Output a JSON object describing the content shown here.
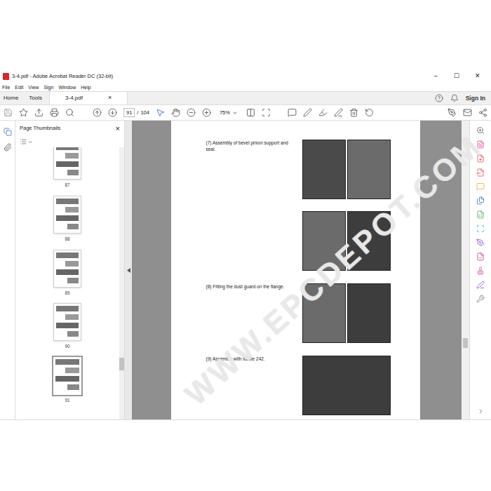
{
  "window": {
    "title": "3-4.pdf - Adobe Acrobat Reader DC (32-bit)",
    "controls": [
      "–",
      "☐",
      "✕"
    ]
  },
  "menu": [
    "File",
    "Edit",
    "View",
    "Sign",
    "Window",
    "Help"
  ],
  "tabs": [
    {
      "label": "Home",
      "selected": false
    },
    {
      "label": "Tools",
      "selected": false
    },
    {
      "label": "3-4.pdf",
      "selected": true
    }
  ],
  "tab_close": "×",
  "account": {
    "sign_in": "Sign In"
  },
  "toolbar": {
    "page": "91",
    "separator": "/",
    "total": "104",
    "zoom": "75%"
  },
  "thumbnails": {
    "title": "Page Thumbnails",
    "close": "×",
    "pages": [
      {
        "number": "87",
        "selected": false
      },
      {
        "number": "88",
        "selected": false
      },
      {
        "number": "89",
        "selected": false
      },
      {
        "number": "90",
        "selected": false
      },
      {
        "number": "91",
        "selected": true
      }
    ]
  },
  "document": {
    "watermark": "WWW.EPCDEPOT.COM",
    "steps": [
      {
        "label": "(7) Assembly of bevel pinion support and seal.",
        "photo_rows": [
          2,
          2
        ]
      },
      {
        "label": "(8) Fitting the dust guard on the flange.",
        "photo_rows": [
          2
        ]
      },
      {
        "label": "(9) Assembly with loctite 242.",
        "photo_rows": [
          1
        ]
      }
    ]
  },
  "scrollbar": {
    "level": 0.86
  },
  "tools_panel": [
    {
      "color": "#5b5b5b"
    },
    {
      "color": "#d93a7a"
    },
    {
      "color": "#e34850"
    },
    {
      "color": "#e34850"
    },
    {
      "color": "#f5a623"
    },
    {
      "color": "#2d6ec9"
    },
    {
      "color": "#3fa34d"
    },
    {
      "color": "#2aa8b8"
    },
    {
      "color": "#8a4fc7"
    },
    {
      "color": "#c4318b"
    },
    {
      "color": "#d43f8d"
    },
    {
      "color": "#7b4fc7"
    },
    {
      "color": "#6e6e6e"
    }
  ]
}
